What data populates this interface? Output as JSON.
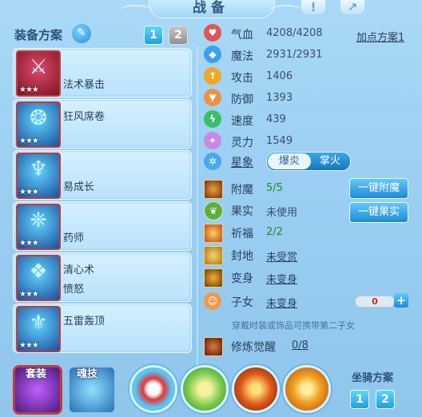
{
  "header": {
    "title": "战备"
  },
  "left": {
    "title": "装备方案",
    "schemes": [
      "1",
      "2"
    ],
    "items": [
      {
        "name": "法术暴击",
        "stars": "★★★"
      },
      {
        "name": "狂风席卷",
        "stars": "★★★"
      },
      {
        "name": "易成长",
        "stars": "★★★"
      },
      {
        "name": "药师",
        "stars": "★★★"
      },
      {
        "name": "清心术",
        "sub": "愤怒",
        "stars": "★★★"
      },
      {
        "name": "五雷轰顶",
        "stars": "★★★"
      }
    ],
    "skills": [
      "套装",
      "魂技"
    ]
  },
  "right": {
    "add_point_plan": "加点方案1",
    "stats": [
      {
        "label": "气血",
        "value": "4208/4208",
        "icon": "heart-icon",
        "color": "#e05656"
      },
      {
        "label": "魔法",
        "value": "2931/2931",
        "icon": "diamond-icon",
        "color": "#3aa0ef"
      },
      {
        "label": "攻击",
        "value": "1406",
        "icon": "sword-icon",
        "color": "#f0a828"
      },
      {
        "label": "防御",
        "value": "1393",
        "icon": "shield-icon",
        "color": "#f09040"
      },
      {
        "label": "速度",
        "value": "439",
        "icon": "bolt-icon",
        "color": "#38c068"
      },
      {
        "label": "灵力",
        "value": "1549",
        "icon": "sparkle-icon",
        "color": "#c888e8"
      }
    ],
    "star": {
      "label": "星象",
      "options": [
        "爆炎",
        "掌火"
      ]
    },
    "enchant": {
      "label": "附魔",
      "value": "5/5"
    },
    "fruit": {
      "label": "果实",
      "value": "未使用"
    },
    "bless": {
      "label": "祈福",
      "value": "2/2"
    },
    "seal": {
      "label": "封地",
      "value": "未受赏"
    },
    "transform": {
      "label": "变身",
      "value": "未变身"
    },
    "child": {
      "label": "子女",
      "value": "未变身",
      "count": "0"
    },
    "note": "穿戴时装或饰品可携带第二子女",
    "cultivate": {
      "label": "修炼觉醒",
      "value": "0/8"
    },
    "buttons": {
      "enchant": "一键附魔",
      "fruit": "一键果实"
    },
    "mount": {
      "title": "坐骑方案",
      "schemes": [
        "1",
        "2"
      ]
    }
  }
}
